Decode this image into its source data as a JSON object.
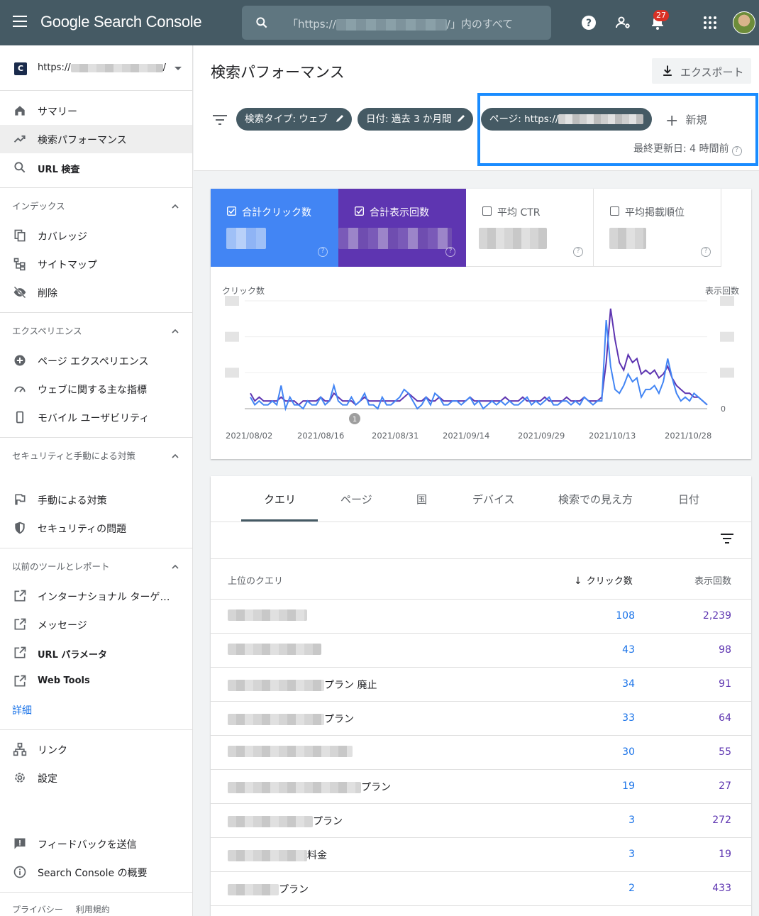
{
  "app": {
    "title": "Google Search Console"
  },
  "search": {
    "prefix": "「https://",
    "suffix": "/」内のすべて"
  },
  "notifications": {
    "count": "27"
  },
  "sidebar": {
    "property_url": "https://",
    "items": [
      {
        "label": "サマリー"
      },
      {
        "label": "検索パフォーマンス"
      },
      {
        "label": "URL 検査"
      }
    ],
    "index_section": "インデックス",
    "index_items": [
      {
        "label": "カバレッジ"
      },
      {
        "label": "サイトマップ"
      },
      {
        "label": "削除"
      }
    ],
    "experience_section": "エクスペリエンス",
    "experience_items": [
      {
        "label": "ページ エクスペリエンス"
      },
      {
        "label": "ウェブに関する主な指標"
      },
      {
        "label": "モバイル ユーザビリティ"
      }
    ],
    "security_section": "セキュリティと手動による対策",
    "security_items": [
      {
        "label": "手動による対策"
      },
      {
        "label": "セキュリティの問題"
      }
    ],
    "legacy_section": "以前のツールとレポート",
    "legacy_items": [
      {
        "label": "インターナショナル ターゲ…"
      },
      {
        "label": "メッセージ"
      },
      {
        "label": "URL パラメータ"
      },
      {
        "label": "Web Tools"
      }
    ],
    "more": "詳細",
    "bottom_items": [
      {
        "label": "リンク"
      },
      {
        "label": "設定"
      }
    ],
    "feedback": "フィードバックを送信",
    "about": "Search Console の概要",
    "footer": [
      "プライバシー",
      "利用規約"
    ]
  },
  "header": {
    "title": "検索パフォーマンス",
    "export_label": "エクスポート"
  },
  "filters": {
    "chips": [
      "検索タイプ: ウェブ",
      "日付: 過去 3 か月間",
      "ページ: https://"
    ],
    "new_label": "新規",
    "last_updated": "最終更新日: 4 時間前"
  },
  "metrics": [
    {
      "label": "合計クリック数",
      "checked": true,
      "color": "#4285f4"
    },
    {
      "label": "合計表示回数",
      "checked": true,
      "color": "#5e35b1"
    },
    {
      "label": "平均 CTR",
      "checked": false
    },
    {
      "label": "平均掲載順位",
      "checked": false
    }
  ],
  "chart_data": {
    "type": "line",
    "y_left_label": "クリック数",
    "y_right_label": "表示回数",
    "y_right_zero": "0",
    "annotation": "1",
    "x_ticks": [
      "2021/08/02",
      "2021/08/16",
      "2021/08/31",
      "2021/09/14",
      "2021/09/29",
      "2021/10/13",
      "2021/10/28"
    ],
    "series": [
      {
        "name": "合計クリック数",
        "color": "#4285f4",
        "values": [
          3,
          1,
          2,
          1,
          1,
          2,
          1,
          6,
          0,
          3,
          1,
          1,
          0,
          2,
          1,
          1,
          3,
          1,
          2,
          6,
          2,
          1,
          1,
          3,
          1,
          2,
          4,
          1,
          1,
          0,
          3,
          1,
          1,
          2,
          3,
          5,
          4,
          2,
          0,
          1,
          3,
          1,
          4,
          3,
          1,
          1,
          2,
          2,
          1,
          2,
          3,
          1,
          2,
          0,
          1,
          2,
          1,
          2,
          1,
          2,
          1,
          1,
          2,
          3,
          1,
          2,
          1,
          2,
          3,
          1,
          1,
          2,
          2,
          1,
          2,
          1,
          3,
          2,
          1,
          2,
          2,
          23,
          11,
          5,
          4,
          6,
          9,
          7,
          8,
          3,
          5,
          5,
          6,
          4,
          7,
          13,
          8,
          4,
          2,
          3,
          2,
          4,
          3,
          2,
          1
        ]
      },
      {
        "name": "合計表示回数",
        "color": "#5e35b1",
        "values": [
          4,
          2,
          3,
          2,
          2,
          2,
          2,
          3,
          2,
          2,
          2,
          1,
          2,
          2,
          2,
          2,
          3,
          2,
          2,
          4,
          3,
          2,
          2,
          2,
          1,
          2,
          3,
          2,
          2,
          2,
          2,
          2,
          2,
          2,
          2,
          3,
          4,
          3,
          2,
          2,
          3,
          2,
          2,
          3,
          2,
          2,
          2,
          2,
          2,
          2,
          3,
          2,
          2,
          2,
          2,
          2,
          2,
          2,
          3,
          2,
          2,
          2,
          3,
          2,
          2,
          2,
          2,
          3,
          2,
          2,
          2,
          2,
          3,
          2,
          2,
          2,
          3,
          2,
          2,
          2,
          3,
          12,
          26,
          18,
          12,
          10,
          14,
          12,
          13,
          9,
          10,
          9,
          10,
          8,
          9,
          11,
          8,
          6,
          5,
          4,
          4,
          3,
          3,
          2,
          1
        ]
      }
    ]
  },
  "table": {
    "tabs": [
      "クエリ",
      "ページ",
      "国",
      "デバイス",
      "検索での見え方",
      "日付"
    ],
    "columns": {
      "query": "上位のクエリ",
      "clicks": "クリック数",
      "impressions": "表示回数"
    },
    "rows": [
      {
        "query": "",
        "clicks": "108",
        "impressions": "2,239"
      },
      {
        "query": "",
        "clicks": "43",
        "impressions": "98"
      },
      {
        "query": "プラン 廃止",
        "clicks": "34",
        "impressions": "91"
      },
      {
        "query": "プラン",
        "clicks": "33",
        "impressions": "64"
      },
      {
        "query": "",
        "clicks": "30",
        "impressions": "55"
      },
      {
        "query": "プラン",
        "clicks": "19",
        "impressions": "27"
      },
      {
        "query": "プラン",
        "clicks": "3",
        "impressions": "272"
      },
      {
        "query": "料金",
        "clicks": "3",
        "impressions": "19"
      },
      {
        "query": "プラン",
        "clicks": "2",
        "impressions": "433"
      }
    ]
  }
}
